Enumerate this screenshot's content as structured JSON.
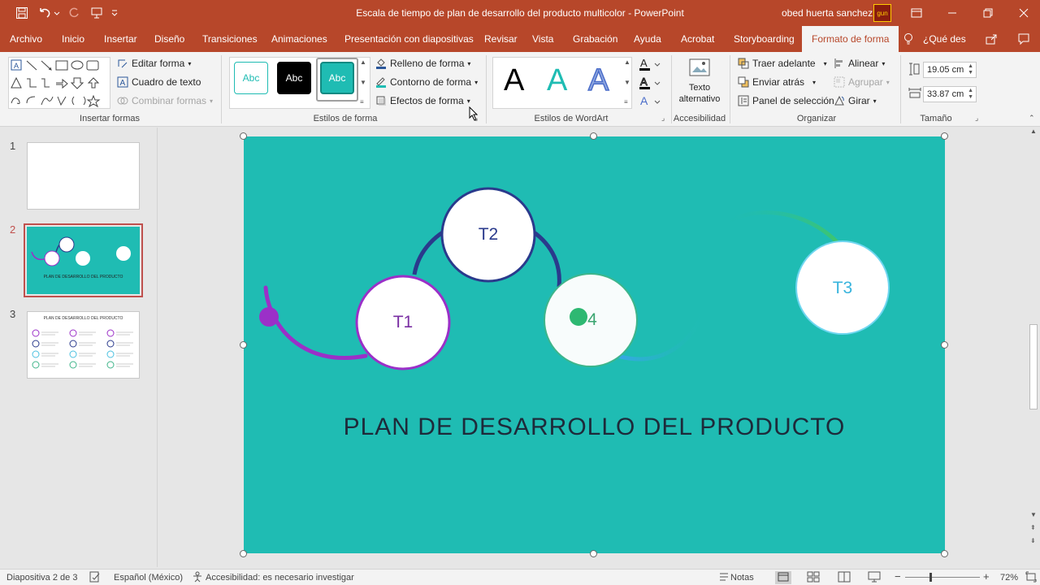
{
  "window": {
    "title": "Escala de tiempo de plan de desarrollo del producto multicolor  -  PowerPoint",
    "user": "obed huerta sanchez",
    "avatar_text": "gun"
  },
  "tabs": [
    "Archivo",
    "Inicio",
    "Insertar",
    "Diseño",
    "Transiciones",
    "Animaciones",
    "Presentación con diapositivas",
    "Revisar",
    "Vista",
    "Grabación",
    "Ayuda",
    "Acrobat",
    "Storyboarding",
    "Formato de forma"
  ],
  "tell_me": "¿Qué des",
  "ribbon": {
    "insert_shapes": {
      "edit_shape": "Editar forma",
      "text_box": "Cuadro de texto",
      "merge_shapes": "Combinar formas",
      "label": "Insertar formas"
    },
    "shape_styles": {
      "swatch_text": "Abc",
      "fill": "Relleno de forma",
      "outline": "Contorno de forma",
      "effects": "Efectos de forma",
      "label": "Estilos de forma"
    },
    "wordart": {
      "letter": "A",
      "label": "Estilos de WordArt"
    },
    "accessibility": {
      "alt_text_line1": "Texto",
      "alt_text_line2": "alternativo",
      "label": "Accesibilidad"
    },
    "arrange": {
      "bring_forward": "Traer adelante",
      "send_backward": "Enviar atrás",
      "selection_pane": "Panel de selección",
      "align": "Alinear",
      "group": "Agrupar",
      "rotate": "Girar",
      "label": "Organizar"
    },
    "size": {
      "height": "19.05 cm",
      "width": "33.87 cm",
      "label": "Tamaño"
    }
  },
  "slides": [
    {
      "number": "1"
    },
    {
      "number": "2"
    },
    {
      "number": "3",
      "title": "PLAN DE DESARROLLO DEL PRODUCTO"
    }
  ],
  "thumb2_title": "PLAN DE DESARROLLO DEL PRODUCTO",
  "slide": {
    "title": "PLAN DE DESARROLLO DEL PRODUCTO",
    "nodes": {
      "t1": "T1",
      "t2": "T2",
      "t3": "T3",
      "t4": "4"
    },
    "background": "#1fbcb3"
  },
  "status": {
    "slide_info": "Diapositiva 2 de 3",
    "language": "Español (México)",
    "accessibility": "Accesibilidad: es necesario investigar",
    "notes": "Notas",
    "zoom": "72%"
  },
  "colors": {
    "accent": "#b7472a",
    "teal": "#1fbcb3",
    "purple": "#9b30c8",
    "navy": "#2a3a8c"
  }
}
